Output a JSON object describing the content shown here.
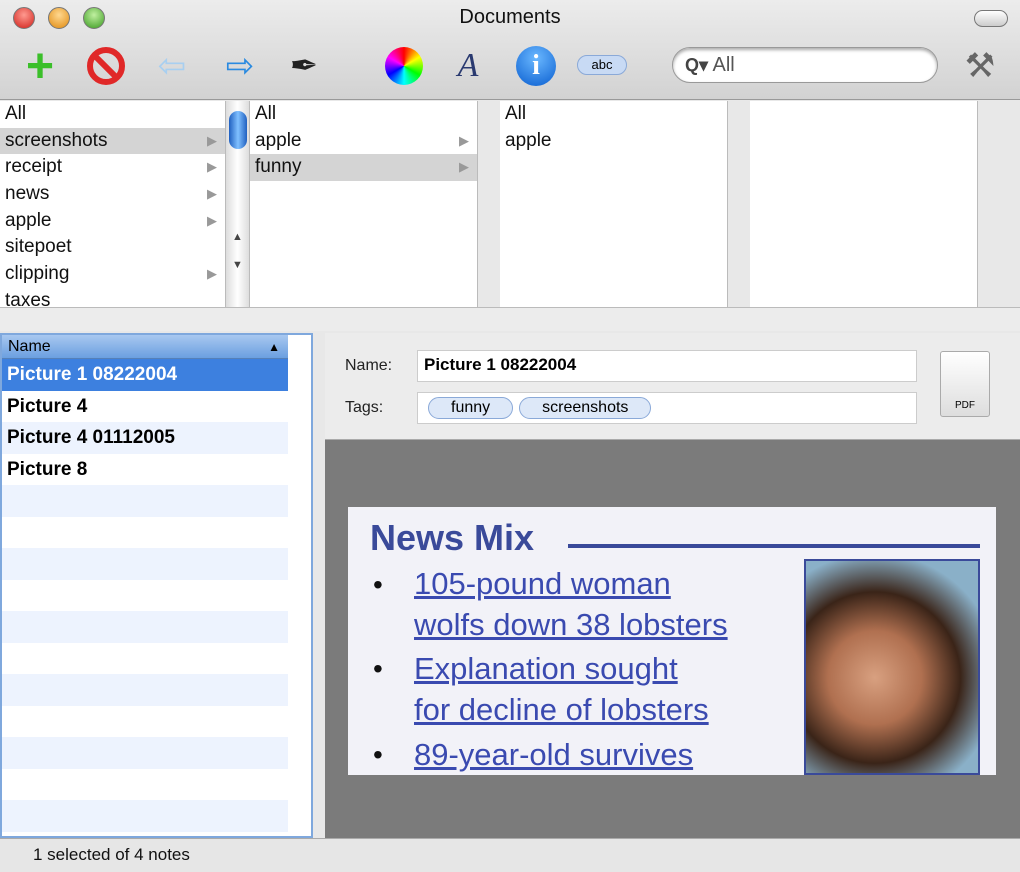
{
  "window": {
    "title": "Documents"
  },
  "toolbar": {
    "add": "+",
    "delete": "⃠",
    "back": "⇦",
    "forward": "⇨",
    "pen": "✒",
    "colors": "",
    "font": "A",
    "info": "i",
    "spelling": "abc",
    "search_value": "All",
    "search_icon": "Q▾",
    "tools": "⚒"
  },
  "browser": {
    "col1": [
      {
        "label": "All"
      },
      {
        "label": "screenshots",
        "arrow": "▶"
      },
      {
        "label": "receipt",
        "arrow": "▶"
      },
      {
        "label": "news",
        "arrow": "▶"
      },
      {
        "label": "apple",
        "arrow": "▶"
      },
      {
        "label": "sitepoet"
      },
      {
        "label": "clipping",
        "arrow": "▶"
      },
      {
        "label": "taxes"
      }
    ],
    "col2": [
      {
        "label": "All"
      },
      {
        "label": "apple",
        "arrow": "▶"
      },
      {
        "label": "funny",
        "arrow": "▶"
      }
    ],
    "col3": [
      {
        "label": "All"
      },
      {
        "label": "apple"
      }
    ]
  },
  "list": {
    "header": "Name",
    "sort_arrow": "▲",
    "rows": [
      "Picture 1 08222004",
      "Picture 4",
      "Picture 4 01112005",
      "Picture 8"
    ]
  },
  "info": {
    "name_label": "Name:",
    "name_value": "Picture 1 08222004",
    "tags_label": "Tags:",
    "tags": [
      "funny",
      "screenshots"
    ],
    "file_type": "PDF"
  },
  "preview": {
    "heading": "News Mix",
    "items": [
      "105-pound woman",
      "wolfs down 38 lobsters",
      "Explanation sought",
      "for decline of lobsters",
      "89-year-old survives"
    ]
  },
  "status": "1 selected of 4 notes"
}
